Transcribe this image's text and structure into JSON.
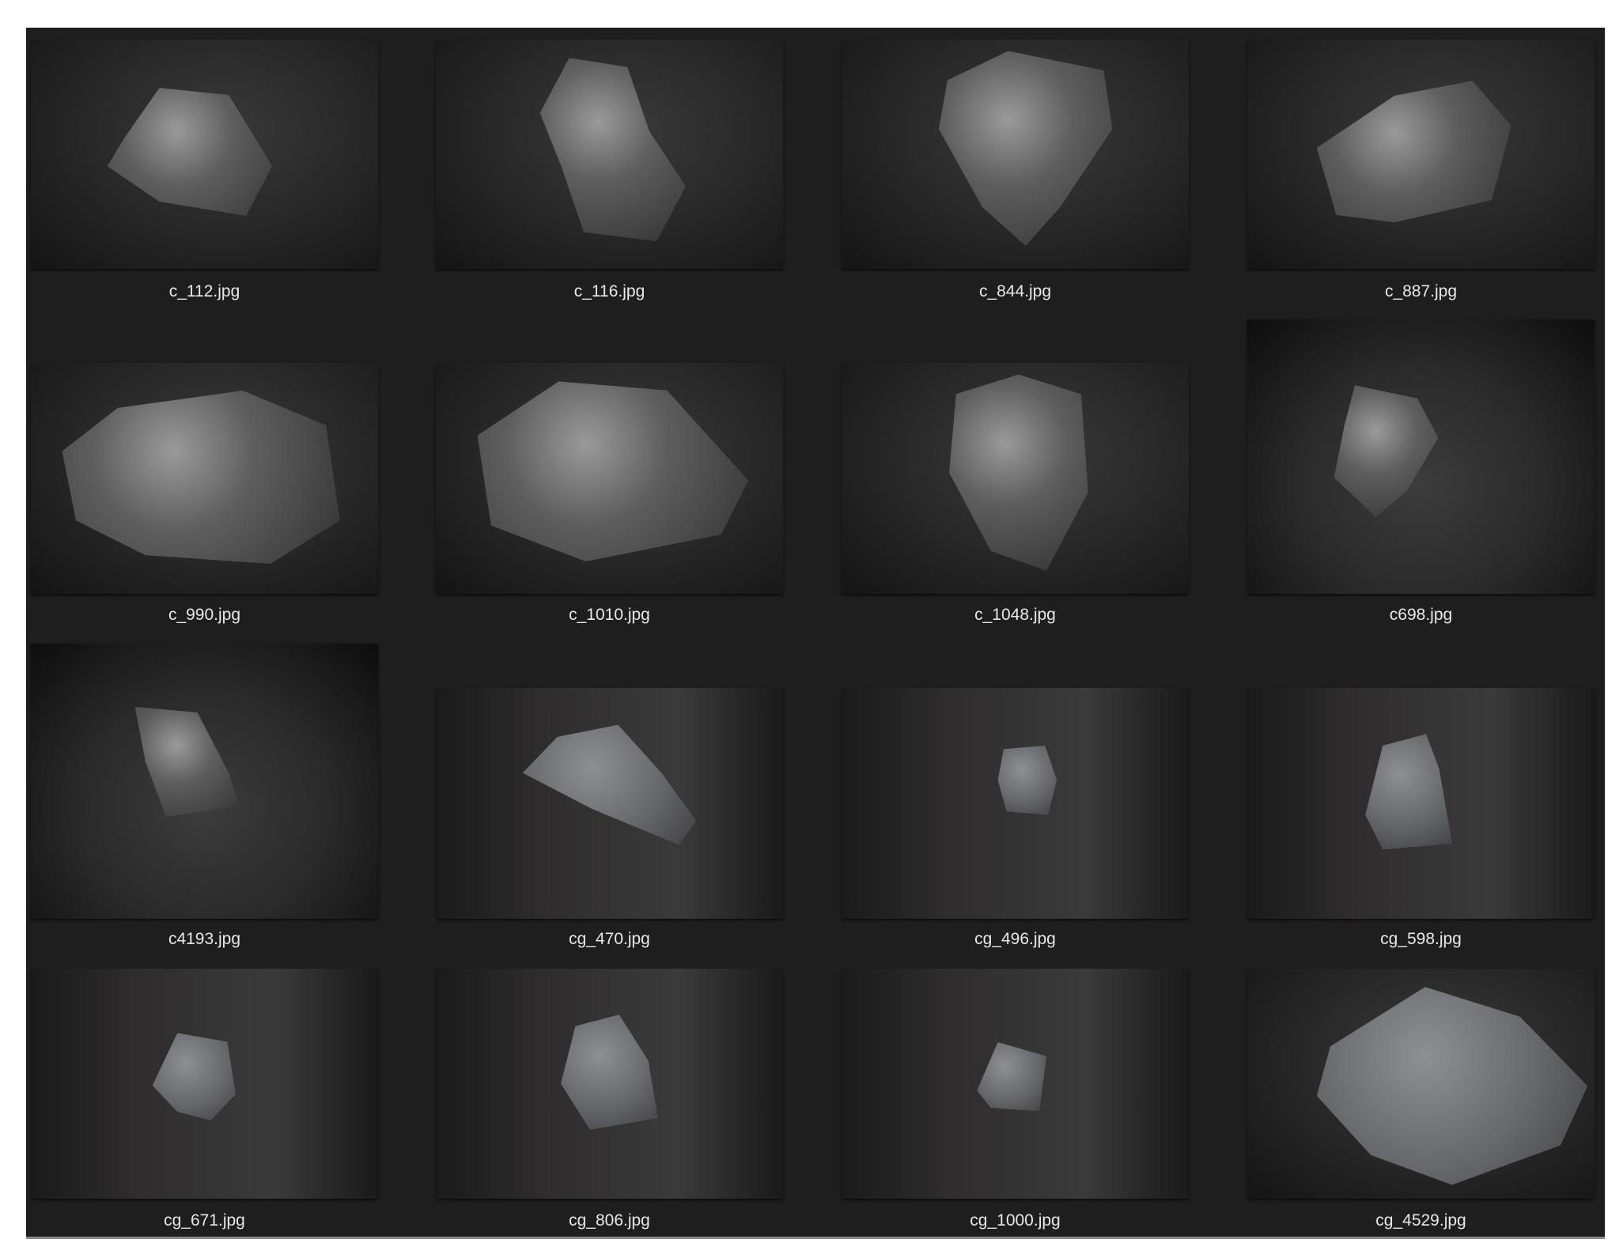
{
  "files": [
    {
      "name": "c_112.jpg"
    },
    {
      "name": "c_116.jpg"
    },
    {
      "name": "c_844.jpg"
    },
    {
      "name": "c_887.jpg"
    },
    {
      "name": "c_990.jpg"
    },
    {
      "name": "c_1010.jpg"
    },
    {
      "name": "c_1048.jpg"
    },
    {
      "name": "c698.jpg"
    },
    {
      "name": "c4193.jpg"
    },
    {
      "name": "cg_470.jpg"
    },
    {
      "name": "cg_496.jpg"
    },
    {
      "name": "cg_598.jpg"
    },
    {
      "name": "cg_671.jpg"
    },
    {
      "name": "cg_806.jpg"
    },
    {
      "name": "cg_1000.jpg"
    },
    {
      "name": "cg_4529.jpg"
    }
  ]
}
